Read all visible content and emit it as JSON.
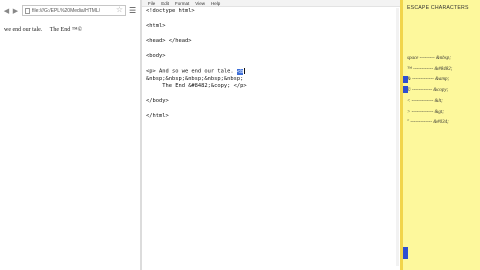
{
  "browser": {
    "nav": {
      "back_icon": "back-arrow-icon",
      "forward_icon": "forward-arrow-icon"
    },
    "url": "file:///G:/EPL%20Media/HTML/",
    "page_text": "we end our tale.     The End ™©"
  },
  "notepad": {
    "menu": [
      "File",
      "Edit",
      "Format",
      "View",
      "Help"
    ],
    "lines": [
      "<!doctype html>",
      "",
      "<html>",
      "",
      "<head> </head>",
      "",
      "<body>",
      "",
      "<p> And so we end our tale.",
      "&nbsp;&nbsp;&nbsp;&nbsp;&nbsp;",
      "     The End &#8482;&copy; </p>",
      "",
      "</body>",
      "",
      "</html>"
    ],
    "selected_text": "<b",
    "after_cursor": " "
  },
  "cheatsheet": {
    "title": "ESCAPE CHARACTERS",
    "rows": [
      "space --------- &nbsp;",
      "™ ------------ &#8482;",
      "& ------------- &amp;",
      "© ------------ &copy;",
      "< ------------- &lt;",
      "> ------------- &gt;",
      "\" ------------- &#034;"
    ]
  },
  "colors": {
    "selection": "#3d6fd8",
    "cheatsheet_background": "#fdf89c",
    "cheatsheet_border": "#f1d54c",
    "row_marker": "#2e4fd1"
  }
}
